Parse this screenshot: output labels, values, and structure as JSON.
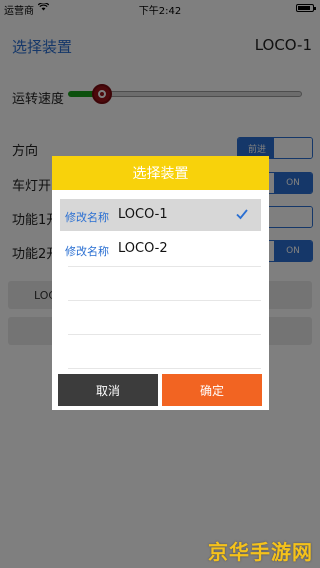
{
  "status_bar": {
    "carrier": "运营商",
    "time": "下午2:42"
  },
  "nav": {
    "title": "选择装置",
    "current_device": "LOCO-1"
  },
  "controls": {
    "speed_label": "运转速度",
    "speed_level": 0.1,
    "direction_label": "方向",
    "direction_option_left": "前进",
    "light_label_partial": "车灯开",
    "light_state": "ON",
    "func1_label_partial": "功能1开",
    "func2_label_partial": "功能2开",
    "func2_state": "ON",
    "bar_label_partial": "LOC"
  },
  "dialog": {
    "title": "选择装置",
    "items": [
      {
        "action": "修改名称",
        "name": "LOCO-1",
        "selected": true
      },
      {
        "action": "修改名称",
        "name": "LOCO-2",
        "selected": false
      }
    ],
    "cancel_label": "取消",
    "confirm_label": "确定"
  },
  "watermark": "京华手游网",
  "colors": {
    "accent_blue": "#2a6fd2",
    "dialog_header": "#f8d20b",
    "confirm_button": "#f26422",
    "cancel_button": "#3c3c3c",
    "slider_fill": "#19a11a",
    "slider_knob": "#9b1219"
  }
}
